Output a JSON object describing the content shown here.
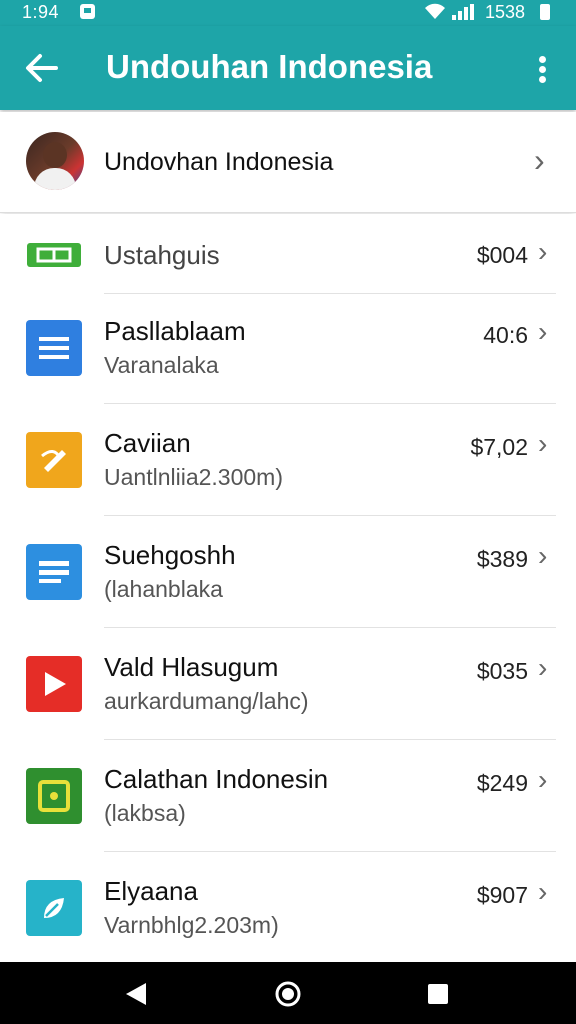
{
  "status_bar": {
    "time": "1:94",
    "battery_text": "1538",
    "icons": [
      "notification-icon",
      "wifi-icon",
      "signal-icon",
      "battery-icon"
    ]
  },
  "app_bar": {
    "title": "Undouhan Indonesia",
    "color": "#1ea5a8"
  },
  "profile": {
    "name": "Undovhan Indonesia"
  },
  "items": [
    {
      "title": "Ustahguis",
      "subtitle": "",
      "price": "$004",
      "icon": "ticket-icon",
      "color": "#3fae3a"
    },
    {
      "title": "Pasllablaam",
      "subtitle": "Varanalaka",
      "price": "40:6",
      "icon": "list-icon",
      "color": "#2f7fe0"
    },
    {
      "title": "Caviian",
      "subtitle": "Uantlnliia2.300m)",
      "price": "$7,02",
      "icon": "pencil-icon",
      "color": "#f0a61c"
    },
    {
      "title": "Suehgoshh",
      "subtitle": "(lahanblaka",
      "price": "$389",
      "icon": "card-icon",
      "color": "#2d8fe0"
    },
    {
      "title": "Vald Hlasugum",
      "subtitle": "aurkardumang/lahc)",
      "price": "$035",
      "icon": "play-icon",
      "color": "#e52d27"
    },
    {
      "title": "Calathan Indonesin",
      "subtitle": "(lakbsa)",
      "price": "$249",
      "icon": "square-target-icon",
      "color": "#2f8f2f"
    },
    {
      "title": "Elyaana",
      "subtitle": "Varnbhlg2.203m)",
      "price": "$907",
      "icon": "leaf-icon",
      "color": "#26b3c9"
    }
  ],
  "nav_bar": {
    "icons": [
      "back-triangle-icon",
      "home-circle-icon",
      "recents-square-icon"
    ]
  }
}
